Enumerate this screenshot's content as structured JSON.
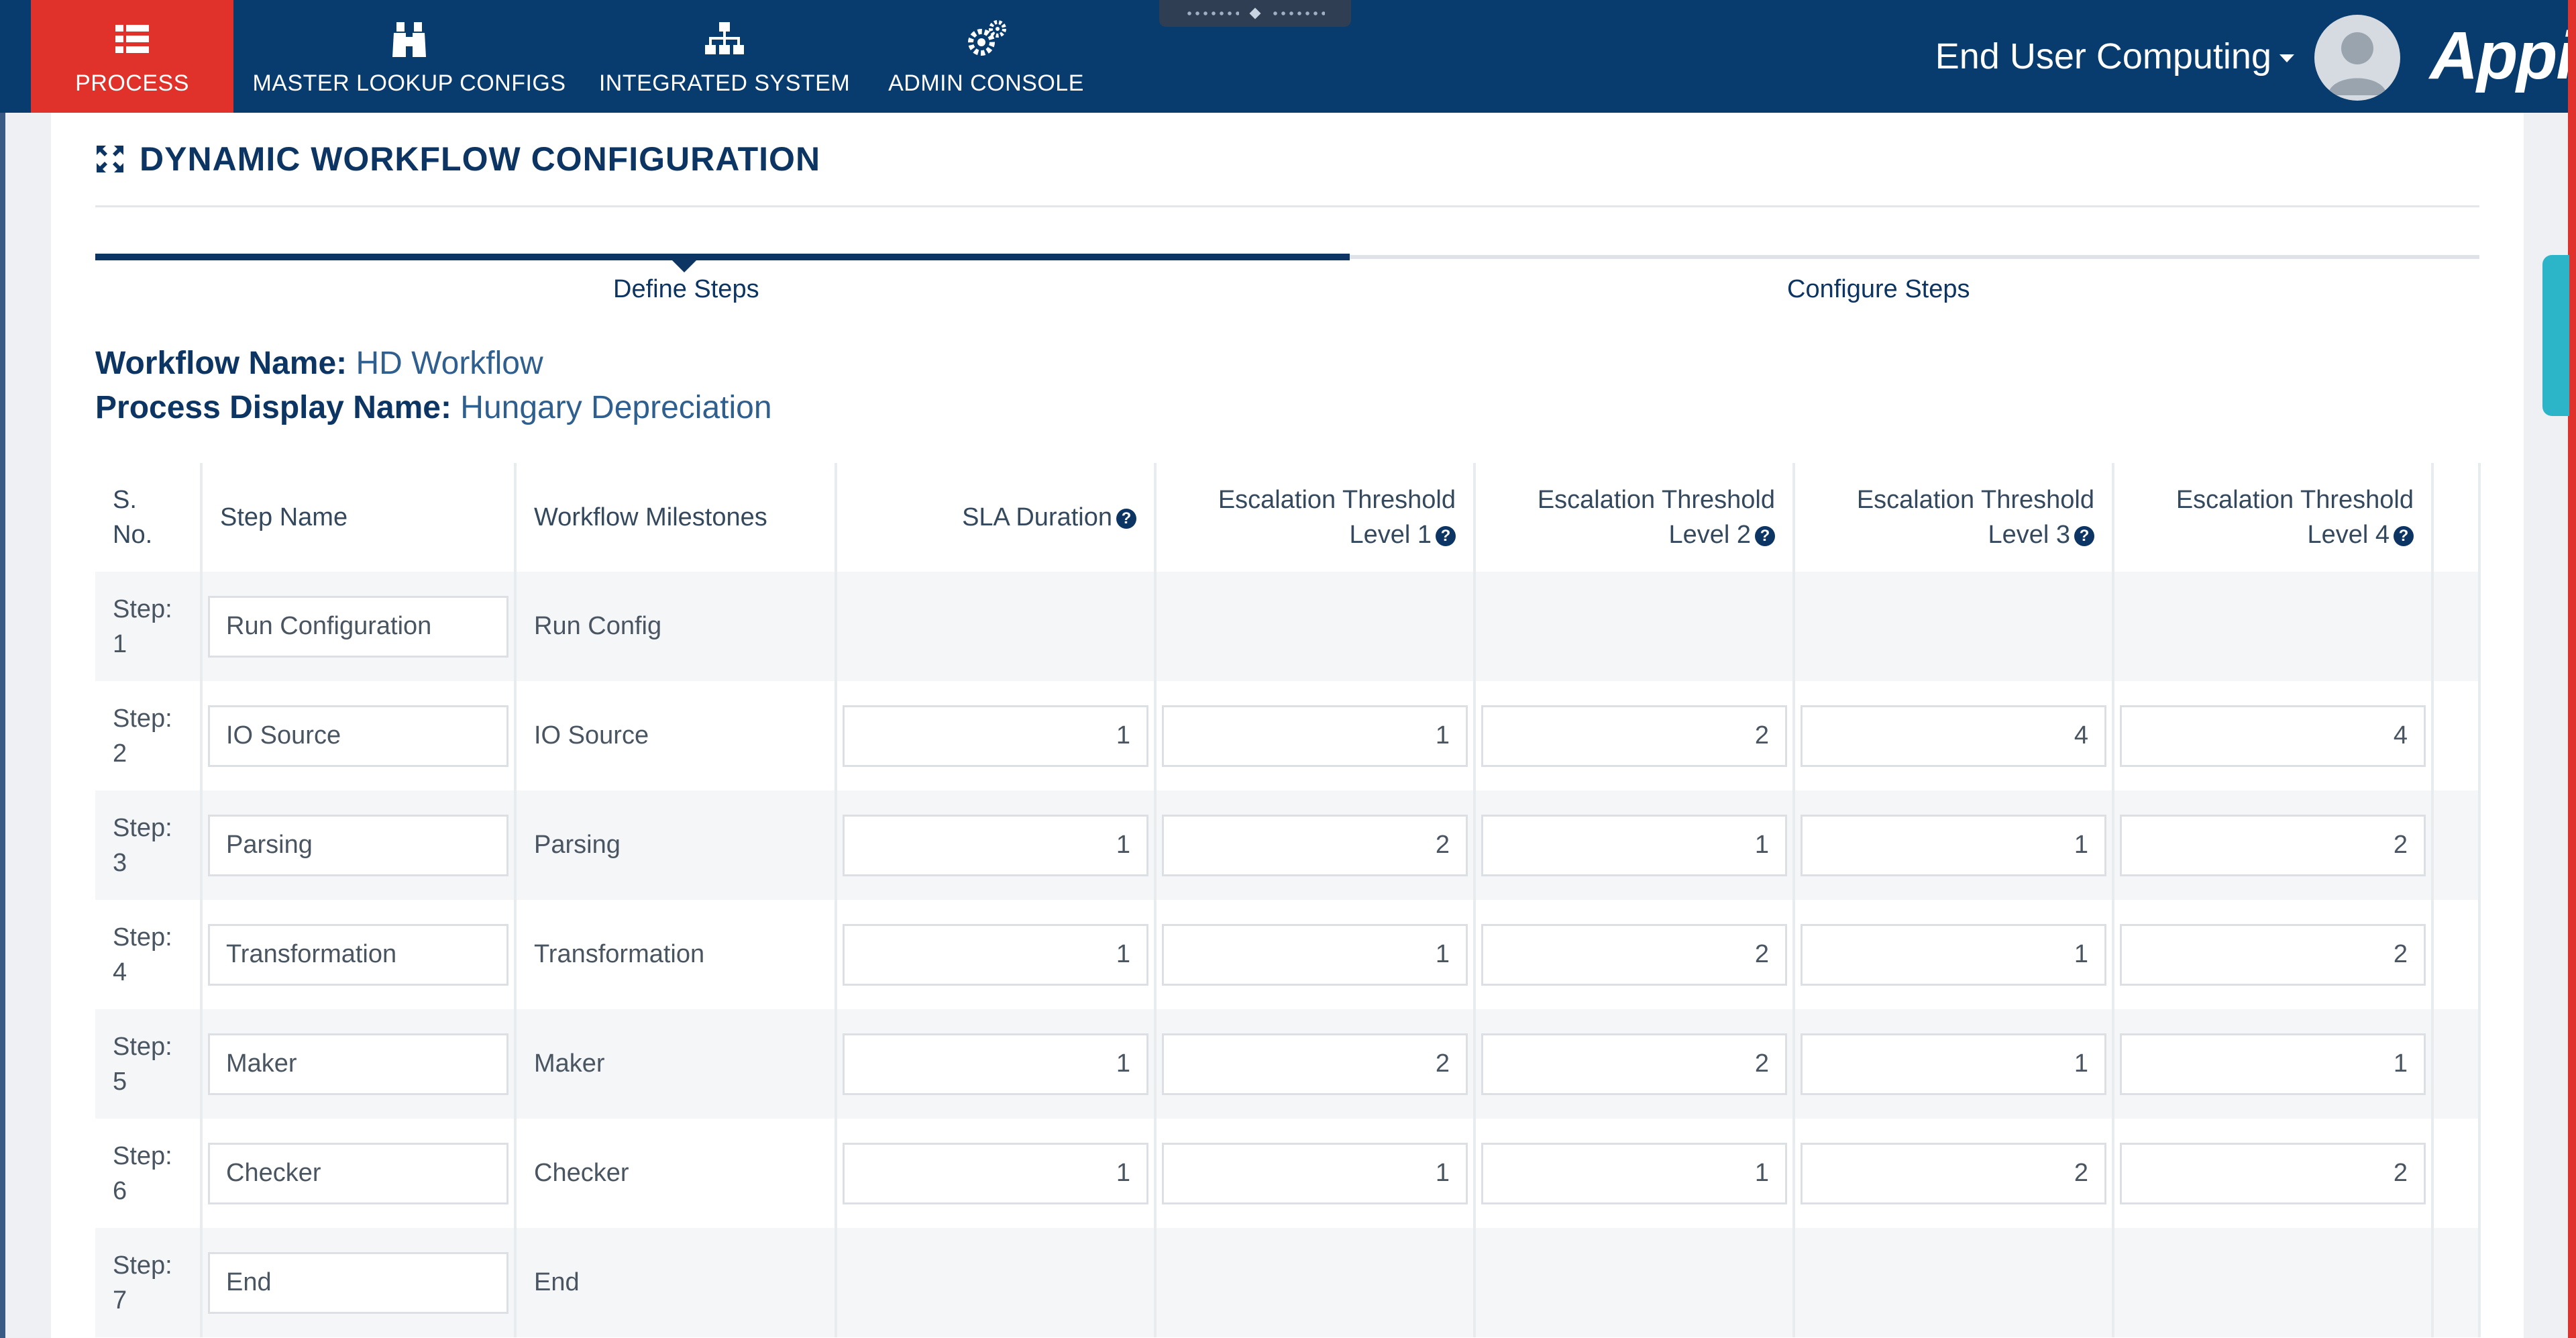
{
  "nav": {
    "items": [
      {
        "label": "PROCESS",
        "icon": "list-icon",
        "active": true
      },
      {
        "label": "MASTER LOOKUP CONFIGS",
        "icon": "binoculars-icon"
      },
      {
        "label": "INTEGRATED SYSTEM",
        "icon": "sitemap-icon"
      },
      {
        "label": "ADMIN CONSOLE",
        "icon": "gears-icon"
      }
    ],
    "user_menu": "End User Computing",
    "brand": "Appian"
  },
  "page": {
    "title": "DYNAMIC WORKFLOW CONFIGURATION",
    "steps": [
      "Define Steps",
      "Configure Steps"
    ],
    "workflow_name_label": "Workflow Name:",
    "workflow_name": "HD Workflow",
    "process_display_label": "Process Display Name:",
    "process_display_name": "Hungary Depreciation"
  },
  "table": {
    "headers": {
      "sno_1": "S.",
      "sno_2": "No.",
      "step_name": "Step Name",
      "milestones": "Workflow Milestones",
      "sla": "SLA Duration",
      "esc1_line1": "Escalation Threshold",
      "esc1_line2": "Level 1",
      "esc2_line1": "Escalation Threshold",
      "esc2_line2": "Level 2",
      "esc3_line1": "Escalation Threshold",
      "esc3_line2": "Level 3",
      "esc4_line1": "Escalation Threshold",
      "esc4_line2": "Level 4"
    },
    "rows": [
      {
        "step_label": "Step:",
        "step_no": "1",
        "step_name": "Run Configuration",
        "milestone": "Run Config",
        "sla": null,
        "esc1": null,
        "esc2": null,
        "esc3": null,
        "esc4": null
      },
      {
        "step_label": "Step:",
        "step_no": "2",
        "step_name": "IO Source",
        "milestone": "IO Source",
        "sla": "1",
        "esc1": "1",
        "esc2": "2",
        "esc3": "4",
        "esc4": "4"
      },
      {
        "step_label": "Step:",
        "step_no": "3",
        "step_name": "Parsing",
        "milestone": "Parsing",
        "sla": "1",
        "esc1": "2",
        "esc2": "1",
        "esc3": "1",
        "esc4": "2"
      },
      {
        "step_label": "Step:",
        "step_no": "4",
        "step_name": "Transformation",
        "milestone": "Transformation",
        "sla": "1",
        "esc1": "1",
        "esc2": "2",
        "esc3": "1",
        "esc4": "2"
      },
      {
        "step_label": "Step:",
        "step_no": "5",
        "step_name": "Maker",
        "milestone": "Maker",
        "sla": "1",
        "esc1": "2",
        "esc2": "2",
        "esc3": "1",
        "esc4": "1"
      },
      {
        "step_label": "Step:",
        "step_no": "6",
        "step_name": "Checker",
        "milestone": "Checker",
        "sla": "1",
        "esc1": "1",
        "esc2": "1",
        "esc3": "2",
        "esc4": "2"
      },
      {
        "step_label": "Step:",
        "step_no": "7",
        "step_name": "End",
        "milestone": "End",
        "sla": null,
        "esc1": null,
        "esc2": null,
        "esc3": null,
        "esc4": null
      }
    ]
  },
  "colors": {
    "nav_bg": "#083b6e",
    "active_tab": "#e0322a",
    "accent_text": "#0c3563"
  }
}
